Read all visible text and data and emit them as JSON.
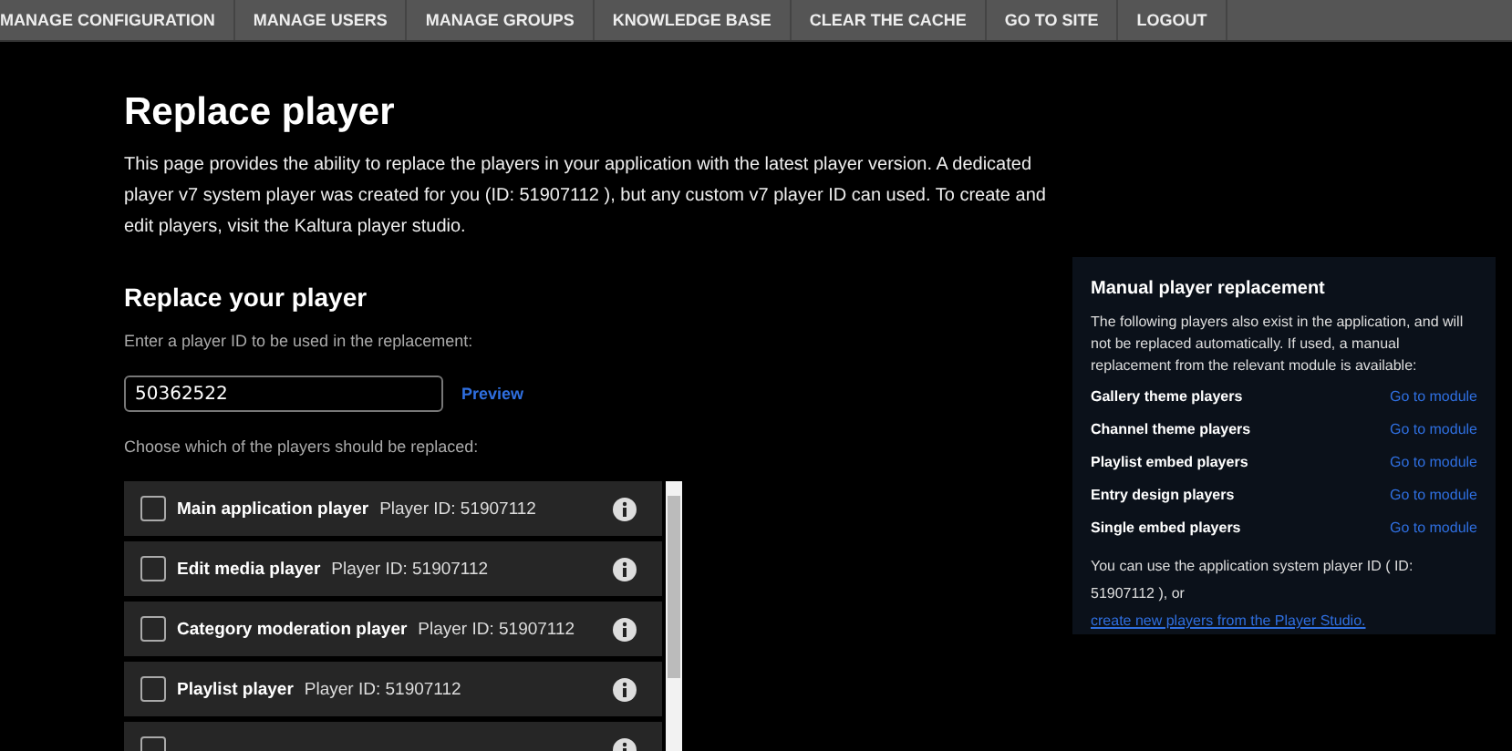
{
  "nav": [
    "MANAGE CONFIGURATION",
    "MANAGE USERS",
    "MANAGE GROUPS",
    "KNOWLEDGE BASE",
    "CLEAR THE CACHE",
    "GO TO SITE",
    "LOGOUT"
  ],
  "title": "Replace player",
  "intro": "This page provides the ability to replace the players in your application with the latest player version. A dedicated player v7 system player was created for you (ID: 51907112 ), but any custom v7 player ID can used. To create and edit players, visit the Kaltura player studio.",
  "section_title": "Replace your player",
  "input_label": "Enter a player ID to be used in the replacement:",
  "player_id": {
    "value": "50362522"
  },
  "preview_link": "Preview",
  "choose_label": "Choose which of the players should be replaced:",
  "players": [
    {
      "name": "Main application player",
      "player_id": "Player ID: 51907112",
      "checked": false
    },
    {
      "name": "Edit media player",
      "player_id": "Player ID: 51907112",
      "checked": false
    },
    {
      "name": "Category moderation player",
      "player_id": "Player ID: 51907112",
      "checked": false
    },
    {
      "name": "Playlist player",
      "player_id": "Player ID: 51907112",
      "checked": false
    },
    {
      "checked": false
    }
  ],
  "sidebar": {
    "title": "Manual player replacement",
    "description": "The following players also exist in the application, and will not be replaced automatically. If used, a manual replacement from the relevant module is available:",
    "items": [
      {
        "label": "Gallery theme players",
        "link": "Go to module"
      },
      {
        "label": "Channel theme players",
        "link": "Go to module"
      },
      {
        "label": "Playlist embed players",
        "link": "Go to module"
      },
      {
        "label": "Entry design players",
        "link": "Go to module"
      },
      {
        "label": "Single embed players",
        "link": "Go to module"
      }
    ],
    "footer_text": "You can use the application system player ID ( ID: 51907112 ), or",
    "footer_link": "create new players from the Player Studio."
  }
}
